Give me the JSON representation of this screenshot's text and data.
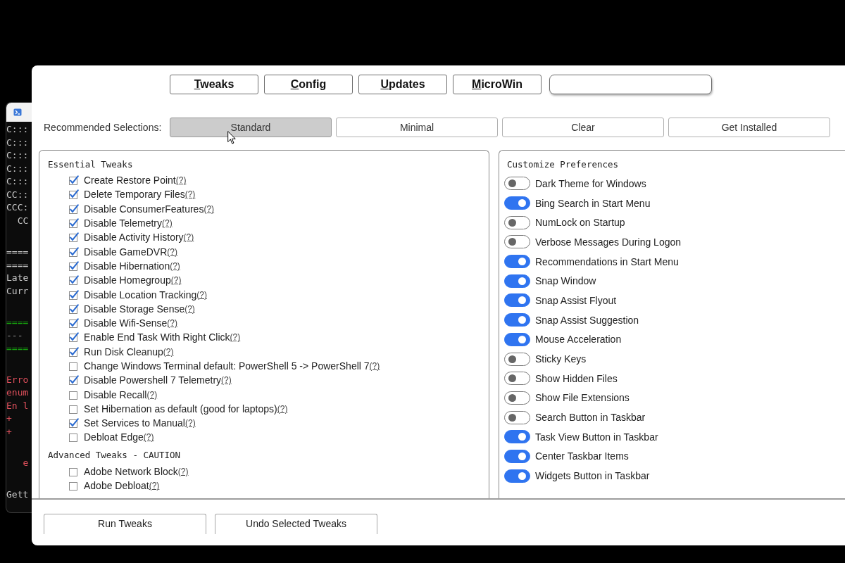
{
  "terminal": {
    "blocks": [
      [
        {
          "text": "C:::",
          "kind": "output"
        },
        {
          "text": "C:::",
          "kind": "output"
        },
        {
          "text": "C:::",
          "kind": "output"
        },
        {
          "text": "C:::",
          "kind": "output"
        },
        {
          "text": "C:::",
          "kind": "output"
        },
        {
          "text": "CC::",
          "kind": "output"
        },
        {
          "text": "CCC:",
          "kind": "output"
        },
        {
          "text": "  CC",
          "kind": "output"
        }
      ],
      [
        {
          "text": "====",
          "kind": "output"
        },
        {
          "text": "====",
          "kind": "output"
        },
        {
          "text": "Late",
          "kind": "output"
        },
        {
          "text": "Curr",
          "kind": "output"
        }
      ],
      [
        {
          "text": "====",
          "kind": "success"
        },
        {
          "text": "---",
          "kind": "muted"
        },
        {
          "text": "====",
          "kind": "success"
        }
      ],
      [
        {
          "text": "Erro",
          "kind": "error"
        },
        {
          "text": "enum",
          "kind": "error"
        },
        {
          "text": "En l",
          "kind": "error"
        },
        {
          "text": "+",
          "kind": "error"
        },
        {
          "text": "+",
          "kind": "error"
        }
      ],
      [
        {
          "text": "   e",
          "kind": "error"
        }
      ],
      [
        {
          "text": "Gett",
          "kind": "output"
        }
      ]
    ]
  },
  "tabs": [
    {
      "label": "Tweaks"
    },
    {
      "label": "Config"
    },
    {
      "label": "Updates"
    },
    {
      "label": "MicroWin"
    }
  ],
  "recommended_selections": {
    "label": "Recommended Selections:",
    "options": [
      {
        "label": "Standard",
        "selected": true
      },
      {
        "label": "Minimal",
        "selected": false
      },
      {
        "label": "Clear",
        "selected": false
      },
      {
        "label": "Get Installed",
        "selected": false
      }
    ]
  },
  "essential_tweaks": {
    "title": "Essential Tweaks",
    "items": [
      {
        "label": "Create Restore Point",
        "help": "(?)",
        "checked": true
      },
      {
        "label": "Delete Temporary Files",
        "help": "(?)",
        "checked": true
      },
      {
        "label": "Disable ConsumerFeatures",
        "help": "(?)",
        "checked": true
      },
      {
        "label": "Disable Telemetry",
        "help": "(?)",
        "checked": true
      },
      {
        "label": "Disable Activity History",
        "help": "(?)",
        "checked": true
      },
      {
        "label": "Disable GameDVR",
        "help": "(?)",
        "checked": true
      },
      {
        "label": "Disable Hibernation",
        "help": "(?)",
        "checked": true
      },
      {
        "label": "Disable Homegroup",
        "help": "(?)",
        "checked": true
      },
      {
        "label": "Disable Location Tracking",
        "help": "(?)",
        "checked": true
      },
      {
        "label": "Disable Storage Sense",
        "help": "(?)",
        "checked": true
      },
      {
        "label": "Disable Wifi-Sense",
        "help": "(?)",
        "checked": true
      },
      {
        "label": "Enable End Task With Right Click",
        "help": "(?)",
        "checked": true
      },
      {
        "label": "Run Disk Cleanup",
        "help": "(?)",
        "checked": true
      },
      {
        "label": "Change Windows Terminal default: PowerShell 5 -> PowerShell 7",
        "help": "(?)",
        "checked": false
      },
      {
        "label": "Disable Powershell 7 Telemetry",
        "help": "(?)",
        "checked": true
      },
      {
        "label": "Disable Recall",
        "help": "(?)",
        "checked": false
      },
      {
        "label": "Set Hibernation as default (good for laptops)",
        "help": "(?)",
        "checked": false
      },
      {
        "label": "Set Services to Manual",
        "help": "(?)",
        "checked": true
      },
      {
        "label": "Debloat Edge",
        "help": "(?)",
        "checked": false
      }
    ]
  },
  "advanced_tweaks": {
    "title": "Advanced Tweaks - CAUTION",
    "items": [
      {
        "label": "Adobe Network Block",
        "help": "(?)",
        "checked": false
      },
      {
        "label": "Adobe Debloat",
        "help": "(?)",
        "checked": false
      }
    ]
  },
  "preferences": {
    "title": "Customize Preferences",
    "items": [
      {
        "label": "Dark Theme for Windows",
        "on": false
      },
      {
        "label": "Bing Search in Start Menu",
        "on": true
      },
      {
        "label": "NumLock on Startup",
        "on": false
      },
      {
        "label": "Verbose Messages During Logon",
        "on": false
      },
      {
        "label": "Recommendations in Start Menu",
        "on": true
      },
      {
        "label": "Snap Window",
        "on": true
      },
      {
        "label": "Snap Assist Flyout",
        "on": true
      },
      {
        "label": "Snap Assist Suggestion",
        "on": true
      },
      {
        "label": "Mouse Acceleration",
        "on": true
      },
      {
        "label": "Sticky Keys",
        "on": false
      },
      {
        "label": "Show Hidden Files",
        "on": false
      },
      {
        "label": "Show File Extensions",
        "on": false
      },
      {
        "label": "Search Button in Taskbar",
        "on": false
      },
      {
        "label": "Task View Button in Taskbar",
        "on": true
      },
      {
        "label": "Center Taskbar Items",
        "on": true
      },
      {
        "label": "Widgets Button in Taskbar",
        "on": true
      }
    ]
  },
  "actions": [
    {
      "label": "Run Tweaks"
    },
    {
      "label": "Undo Selected Tweaks"
    }
  ]
}
